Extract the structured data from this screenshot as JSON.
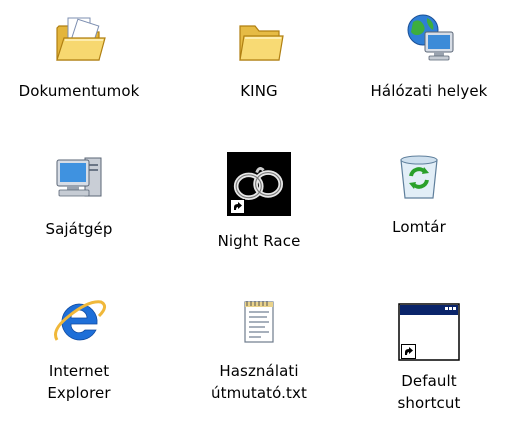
{
  "desktop": {
    "icons": [
      {
        "label": "Dokumentumok",
        "icon": "open-folder-document-icon"
      },
      {
        "label": "KING",
        "icon": "folder-icon"
      },
      {
        "label": "Hálózati helyek",
        "icon": "network-places-icon"
      },
      {
        "label": "Sajátgép",
        "icon": "my-computer-icon"
      },
      {
        "label": "Night Race",
        "icon": "handcuffs-icon",
        "shortcut": true
      },
      {
        "label": "Lomtár",
        "icon": "recycle-bin-icon"
      },
      {
        "label": "Internet\nExplorer",
        "icon": "internet-explorer-icon"
      },
      {
        "label": "Használati\nútmutató.txt",
        "icon": "text-file-icon"
      },
      {
        "label": "Default\nshortcut",
        "icon": "default-window-icon",
        "shortcut": true
      }
    ]
  },
  "colors": {
    "background": "#ffffff",
    "label_text": "#000000",
    "folder_yellow": "#f5d66b",
    "recycle_green": "#2aa02a",
    "ie_blue": "#1e6fd8",
    "window_titlebar": "#0a246a"
  }
}
